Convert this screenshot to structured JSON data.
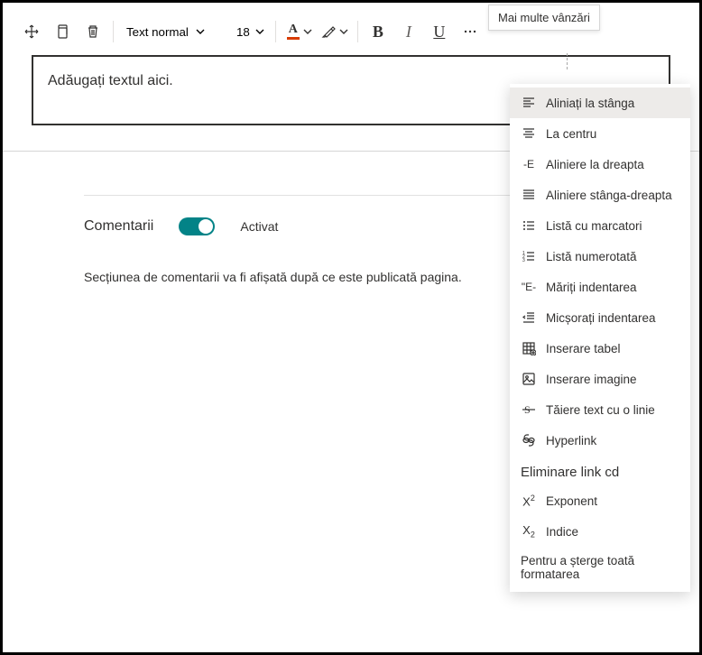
{
  "tooltip": "Mai multe vânzări",
  "toolbar": {
    "text_style": "Text normal",
    "font_size": "18"
  },
  "editor": {
    "placeholder": "Adăugați textul aici."
  },
  "comments": {
    "title": "Comentarii",
    "toggle_state": "Activat",
    "note": "Secțiunea de comentarii va fi afișată după ce este publicată pagina."
  },
  "dropdown": {
    "items": [
      {
        "icon": "align-left",
        "label": "Aliniați la stânga",
        "hovered": true
      },
      {
        "icon": "align-center",
        "label": "La centru"
      },
      {
        "icon": "align-right-text",
        "label": "Aliniere la dreapta"
      },
      {
        "icon": "align-justify",
        "label": "Aliniere stânga-dreapta"
      },
      {
        "icon": "bullets",
        "label": "Listă cu marcatori"
      },
      {
        "icon": "numbers",
        "label": "Listă numerotată"
      },
      {
        "icon": "indent-inc-text",
        "label": "Măriți indentarea"
      },
      {
        "icon": "indent-dec",
        "label": "Micșorați indentarea"
      },
      {
        "icon": "table",
        "label": "Inserare tabel"
      },
      {
        "icon": "image",
        "label": "Inserare imagine"
      },
      {
        "icon": "strike",
        "label": "Tăiere text cu o linie"
      },
      {
        "icon": "link",
        "label": "Hyperlink"
      }
    ],
    "remove_link": "Eliminare link cd",
    "footer_items": [
      {
        "icon": "sup",
        "label": "Exponent"
      },
      {
        "icon": "sub",
        "label": "Indice"
      }
    ],
    "clear": "Pentru a șterge toată formatarea"
  }
}
